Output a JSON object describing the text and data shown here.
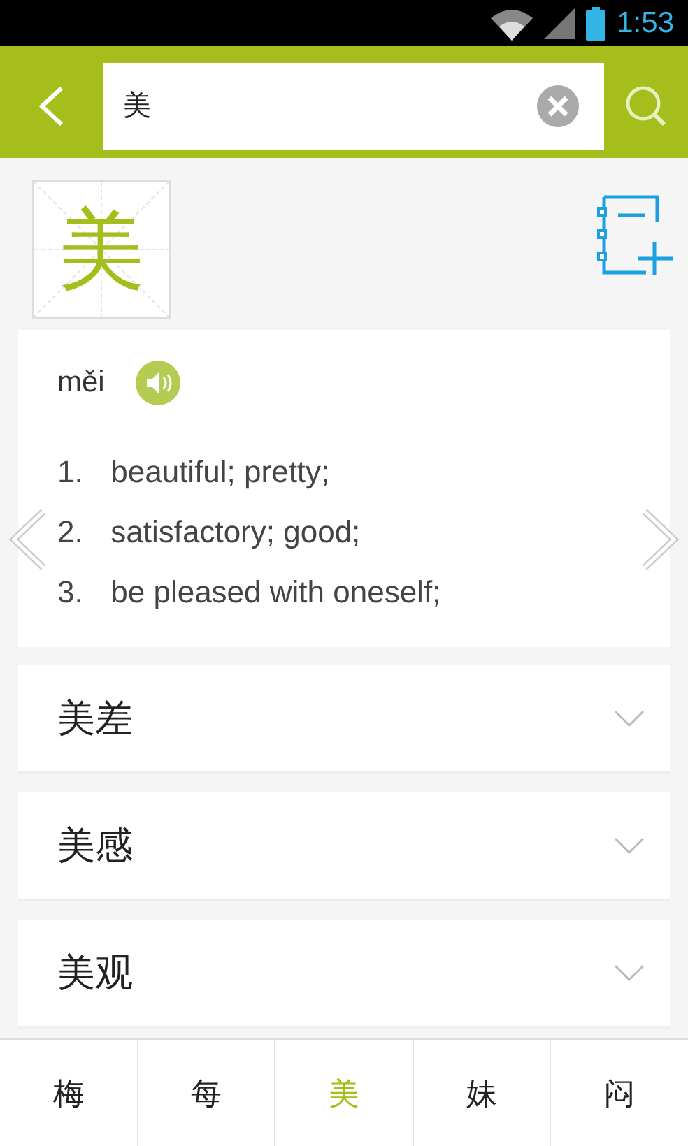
{
  "status_bar": {
    "time": "1:53"
  },
  "search": {
    "value": "美"
  },
  "entry": {
    "character": "美",
    "pinyin": "měi",
    "definitions": [
      {
        "number": "1.",
        "text": "beautiful; pretty;"
      },
      {
        "number": "2.",
        "text": "satisfactory; good;"
      },
      {
        "number": "3.",
        "text": "be pleased with oneself;"
      }
    ]
  },
  "compounds": [
    {
      "word": "美差",
      "expanded": false
    },
    {
      "word": "美感",
      "expanded": false
    },
    {
      "word": "美观",
      "expanded": false
    }
  ],
  "tabs": [
    {
      "label": "梅",
      "selected": false
    },
    {
      "label": "每",
      "selected": false
    },
    {
      "label": "美",
      "selected": true
    },
    {
      "label": "妹",
      "selected": false
    },
    {
      "label": "闷",
      "selected": false
    }
  ]
}
